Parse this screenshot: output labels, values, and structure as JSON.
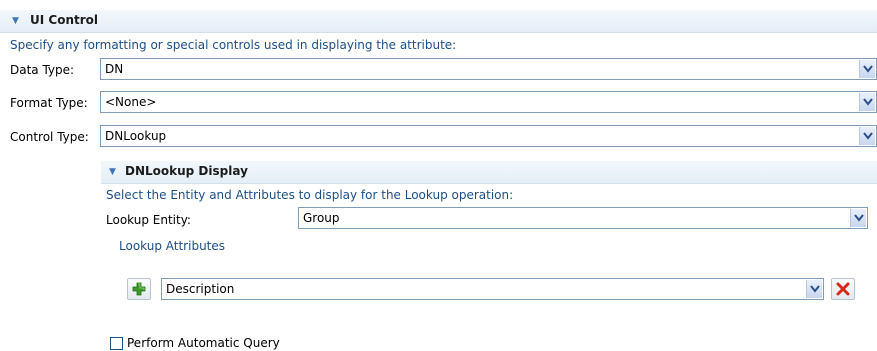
{
  "ui_control": {
    "title": "UI Control",
    "description": "Specify any formatting or special controls used in displaying the attribute:",
    "fields": {
      "data_type": {
        "label": "Data Type:",
        "value": "DN"
      },
      "format_type": {
        "label": "Format Type:",
        "value": "<None>"
      },
      "control_type": {
        "label": "Control Type:",
        "value": "DNLookup"
      }
    }
  },
  "dnlookup": {
    "title": "DNLookup Display",
    "description": "Select the Entity and Attributes to display for the Lookup operation:",
    "lookup_entity": {
      "label": "Lookup Entity:",
      "value": "Group"
    },
    "lookup_attributes_label": "Lookup Attributes",
    "attributes": [
      {
        "value": "Description"
      }
    ],
    "perform_auto_query": {
      "label": "Perform Automatic Query",
      "checked": false
    }
  },
  "icons": {
    "twistie": "expand-twistie-icon",
    "add": "plus-icon",
    "remove": "delete-x-icon",
    "dropdown": "chevron-down-icon"
  },
  "colors": {
    "accent_text": "#1d4f86",
    "header_bg": "#e4eef7",
    "add_green": "#3a9a2a",
    "remove_red": "#d42a1a"
  }
}
